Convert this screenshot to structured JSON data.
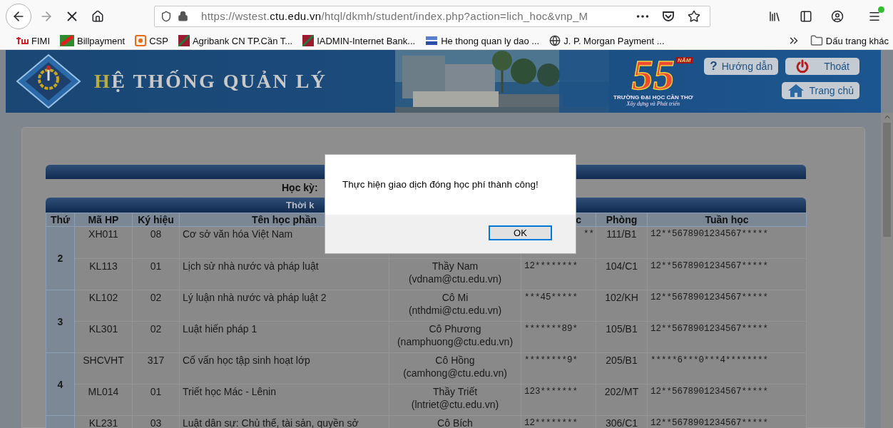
{
  "browser": {
    "url": {
      "prefix": "https://wstest.",
      "domain": "ctu.edu.vn",
      "path": "/htql/dkmh/student/index.php?action=lich_hoc&vnp_M"
    },
    "bookmarks": [
      {
        "label": "FIMI"
      },
      {
        "label": "Billpayment"
      },
      {
        "label": "CSP"
      },
      {
        "label": "Agribank CN TP.Cần T..."
      },
      {
        "label": "IADMIN-Internet Bank..."
      },
      {
        "label": "He thong quan ly dao ..."
      },
      {
        "label": "J. P. Morgan Payment ..."
      }
    ],
    "other_bookmarks": "Dấu trang khác"
  },
  "banner": {
    "title": "HỆ THỐNG QUẢN LÝ",
    "anniversary": {
      "number": "55",
      "word": "NĂM",
      "caption": "TRƯỜNG ĐẠI HỌC CẦN THƠ",
      "slogan": "Xây dựng và Phát triển"
    },
    "buttons": [
      {
        "label": "Hướng dẫn",
        "kind": "help",
        "icon": "?"
      },
      {
        "label": "Thoát",
        "kind": "logout"
      },
      {
        "label": "Trang chủ",
        "kind": "home"
      }
    ]
  },
  "schedule": {
    "semester_label": "Học kỳ:",
    "section_title": "Thời k",
    "columns": [
      {
        "label": "Thứ"
      },
      {
        "label": "Mã HP"
      },
      {
        "label": "Ký hiệu"
      },
      {
        "label": "Tên học phần"
      },
      {},
      {
        "label": "c",
        "cut": true
      },
      {
        "label": "Phòng"
      },
      {
        "label": "Tuần học"
      }
    ],
    "groups": [
      {
        "day": "2",
        "rows": [
          {
            "code": "XH011",
            "symbol": "08",
            "name": "Cơ sở văn hóa Việt Nam",
            "schedule": "**",
            "schedule_cut": true,
            "room": "111/B1",
            "weeks": "12**5678901234567*****"
          },
          {
            "code": "KL113",
            "symbol": "01",
            "name": "Lịch sử nhà nước và pháp luật",
            "teacher": "Thầy Nam",
            "email": "(vdnam@ctu.edu.vn)",
            "schedule": "12********",
            "room": "104/C1",
            "weeks": "12**5678901234567*****"
          }
        ]
      },
      {
        "day": "3",
        "rows": [
          {
            "code": "KL102",
            "symbol": "02",
            "name": "Lý luận nhà nước và pháp luật 2",
            "teacher": "Cô Mi",
            "email": "(nthdmi@ctu.edu.vn)",
            "schedule": "***45*****",
            "room": "102/KH",
            "weeks": "12**5678901234567*****"
          },
          {
            "code": "KL301",
            "symbol": "02",
            "name": "Luật hiến pháp 1",
            "teacher": "Cô Phương",
            "email": "(namphuong@ctu.edu.vn)",
            "schedule": "*******89*",
            "room": "105/B1",
            "weeks": "12**5678901234567*****"
          }
        ]
      },
      {
        "day": "4",
        "rows": [
          {
            "code": "SHCVHT",
            "symbol": "317",
            "name": "Cố vấn học tập sinh hoạt lớp",
            "teacher": "Cô Hồng",
            "email": "(camhong@ctu.edu.vn)",
            "schedule": "********9*",
            "room": "205/B1",
            "weeks": "*****6***0***4********"
          },
          {
            "code": "ML014",
            "symbol": "01",
            "name": "Triết học Mác - Lênin",
            "teacher": "Thầy Triết",
            "email": "(lntriet@ctu.edu.vn)",
            "schedule": "123*******",
            "room": "202/MT",
            "weeks": "12**5678901234567*****"
          }
        ]
      },
      {
        "rows": [
          {
            "code": "KL231",
            "symbol": "03",
            "name": "Luật dân sự: Chủ thể, tài sản, quyền sở",
            "teacher": "Cô Bích",
            "schedule": "12********",
            "room": "306/C1",
            "weeks": "12**5678901234567*****"
          }
        ]
      }
    ]
  },
  "dialog": {
    "message": "Thực hiện giao dịch đóng học phí thành công!",
    "button": "OK"
  }
}
